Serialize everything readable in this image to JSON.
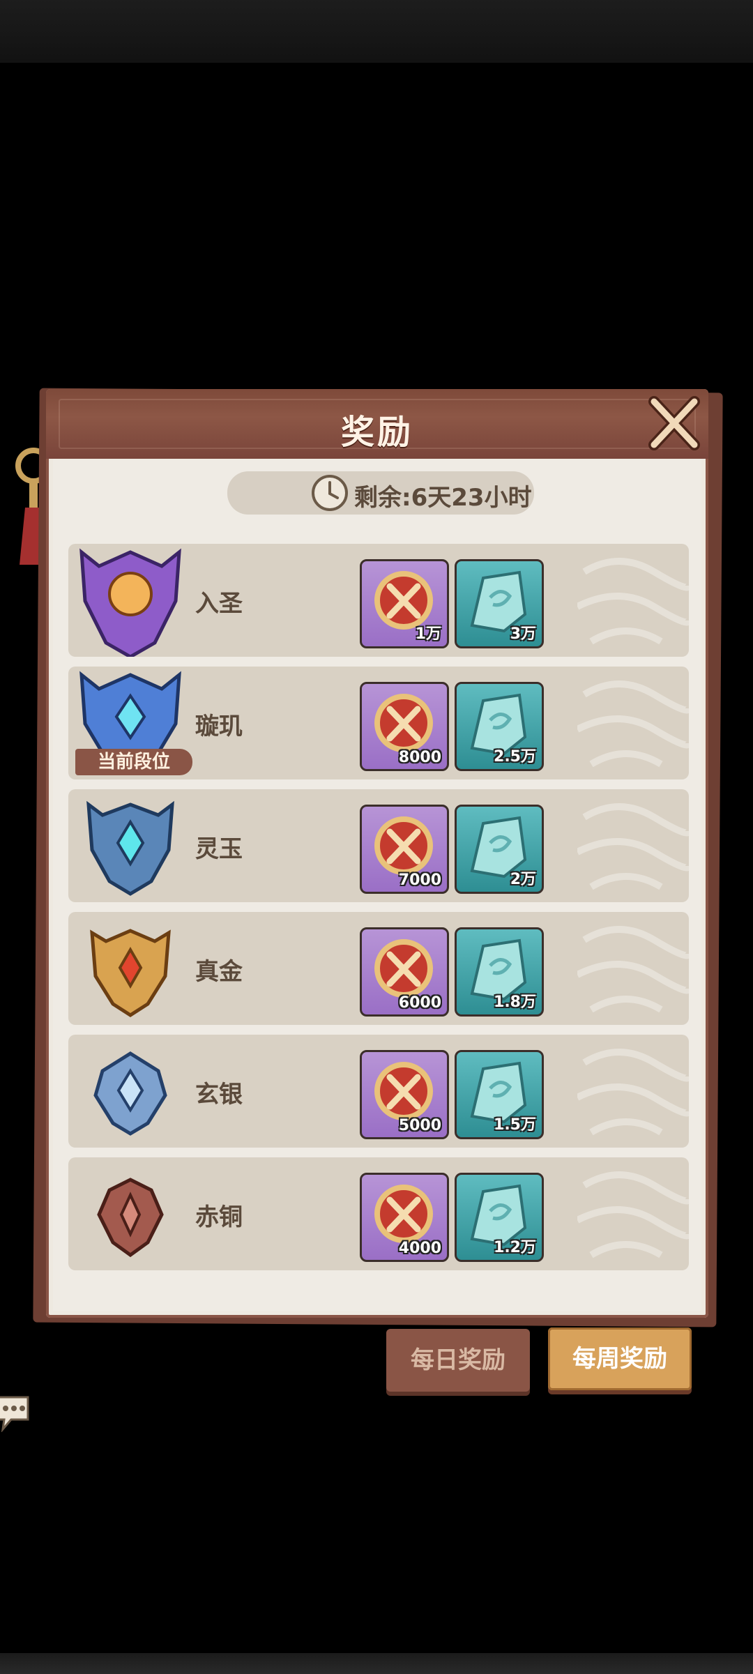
{
  "header": {
    "title": "奖励"
  },
  "timer": {
    "text": "剩余:6天23小时"
  },
  "ranks": [
    {
      "name": "入圣",
      "medal": "purple-crown-medal-icon",
      "rewards": [
        "1万",
        "3万"
      ],
      "current": false
    },
    {
      "name": "璇玑",
      "medal": "blue-crown-medal-icon",
      "rewards": [
        "8000",
        "2.5万"
      ],
      "current": true
    },
    {
      "name": "灵玉",
      "medal": "jade-medal-icon",
      "rewards": [
        "7000",
        "2万"
      ],
      "current": false
    },
    {
      "name": "真金",
      "medal": "gold-medal-icon",
      "rewards": [
        "6000",
        "1.8万"
      ],
      "current": false
    },
    {
      "name": "玄银",
      "medal": "silver-medal-icon",
      "rewards": [
        "5000",
        "1.5万"
      ],
      "current": false
    },
    {
      "name": "赤铜",
      "medal": "bronze-medal-icon",
      "rewards": [
        "4000",
        "1.2万"
      ],
      "current": false
    }
  ],
  "current_tag": "当前段位",
  "tabs": {
    "daily": "每日奖励",
    "weekly": "每周奖励"
  },
  "colors": {
    "panel_header": "#8d5746",
    "item_purple": "#9a6fc6",
    "item_teal": "#2e8e93",
    "active_tab": "#d8a25b"
  }
}
